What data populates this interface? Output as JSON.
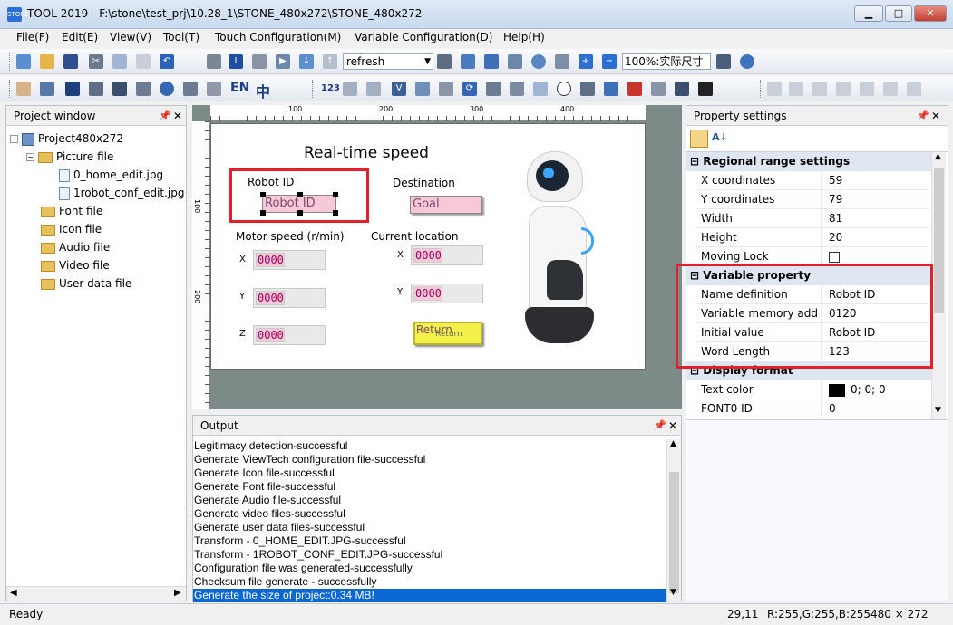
{
  "window": {
    "title": "TOOL 2019 - F:\\stone\\test_prj\\10.28_1\\STONE_480x272\\STONE_480x272",
    "app_icon_text": "STONE"
  },
  "window_buttons": {
    "minimize": "▁",
    "maximize": "□",
    "close": "✕"
  },
  "menu": [
    "File(F)",
    "Edit(E)",
    "View(V)",
    "Tool(T)",
    "Touch Configuration(M)",
    "Variable Configuration(D)",
    "Help(H)"
  ],
  "toolbar": {
    "refresh_select": "refresh",
    "zoom_select": "100%:实际尺寸",
    "en_label": "EN",
    "zh_label": "中",
    "num_label": "123"
  },
  "project_window": {
    "title": "Project window",
    "root": "Project480x272",
    "items": [
      "Picture file",
      "0_home_edit.jpg",
      "1robot_conf_edit.jpg",
      "Font file",
      "Icon file",
      "Audio file",
      "Video file",
      "User data file"
    ]
  },
  "ruler": {
    "h_labels": [
      "100",
      "200",
      "300",
      "400"
    ],
    "v_labels": [
      "100",
      "200"
    ]
  },
  "screen": {
    "title": "Real-time speed",
    "robot_id_label": "Robot ID",
    "robot_id_value": "Robot ID",
    "destination_label": "Destination",
    "destination_value": "Goal",
    "motor_speed_label": "Motor speed (r/min)",
    "current_location_label": "Current location",
    "axis_x": "X",
    "axis_y": "Y",
    "axis_z": "Z",
    "zero": "0000",
    "return_label": "Return",
    "return_sub": "Return"
  },
  "output": {
    "title": "Output",
    "lines": [
      "Legitimacy detection-successful",
      "Generate ViewTech configuration file-successful",
      "Generate Icon file-successful",
      "Generate Font file-successful",
      "Generate Audio file-successful",
      "Generate video files-successful",
      "Generate user data files-successful",
      "Transform - 0_HOME_EDIT.JPG-successful",
      "Transform - 1ROBOT_CONF_EDIT.JPG-successful",
      "Configuration file was generated-successfully",
      "Checksum file generate - successfully",
      "Generate the size of project:0.34 MB!"
    ]
  },
  "properties": {
    "title": "Property settings",
    "categories": [
      {
        "name": "Regional range settings",
        "rows": [
          {
            "k": "X coordinates",
            "v": "59"
          },
          {
            "k": "Y coordinates",
            "v": "79"
          },
          {
            "k": "Width",
            "v": "81"
          },
          {
            "k": "Height",
            "v": "20"
          },
          {
            "k": "Moving Lock",
            "v": ""
          }
        ]
      },
      {
        "name": "Variable property",
        "rows": [
          {
            "k": "Name definition",
            "v": "Robot ID"
          },
          {
            "k": "Variable memory add",
            "v": "0120"
          },
          {
            "k": "Initial value",
            "v": "Robot ID"
          },
          {
            "k": "Word Length",
            "v": "123"
          }
        ]
      },
      {
        "name": "Display format",
        "rows": [
          {
            "k": "Text color",
            "v": "0; 0; 0"
          },
          {
            "k": "FONT0 ID",
            "v": "0"
          }
        ]
      }
    ]
  },
  "status": {
    "ready": "Ready",
    "coords": "29,11",
    "color": "R:255,G:255,B:255",
    "size": "480 × 272"
  },
  "colors": {
    "highlight_red": "#e0202a",
    "selection_blue": "#0a68d2",
    "canvas_bg": "#7c8a88"
  }
}
